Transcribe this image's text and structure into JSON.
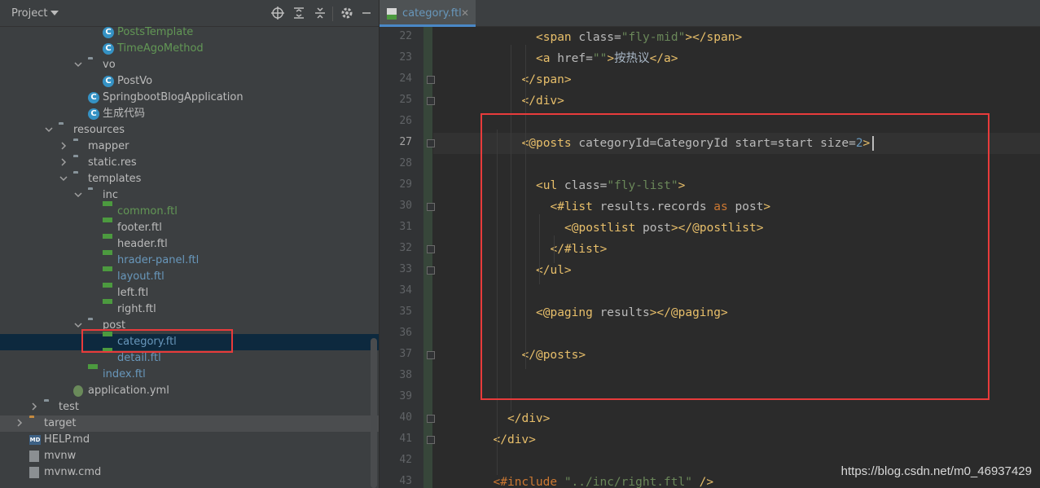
{
  "project_panel": {
    "title": "Project",
    "tree": [
      {
        "label": "PostsTemplate",
        "icon": "class-icon",
        "color": "c-green",
        "depth": 6,
        "arrow": ""
      },
      {
        "label": "TimeAgoMethod",
        "icon": "class-icon",
        "color": "c-green",
        "depth": 6,
        "arrow": ""
      },
      {
        "label": "vo",
        "icon": "folder-icon",
        "color": "c-default",
        "depth": 5,
        "arrow": "down"
      },
      {
        "label": "PostVo",
        "icon": "class-icon",
        "color": "c-default",
        "depth": 6,
        "arrow": ""
      },
      {
        "label": "SpringbootBlogApplication",
        "icon": "class-icon",
        "color": "c-default",
        "depth": 5,
        "arrow": ""
      },
      {
        "label": "生成代码",
        "icon": "class-icon",
        "color": "c-default",
        "depth": 5,
        "arrow": ""
      },
      {
        "label": "resources",
        "icon": "folder-icon",
        "color": "c-default",
        "depth": 3,
        "arrow": "down"
      },
      {
        "label": "mapper",
        "icon": "folder-icon",
        "color": "c-default",
        "depth": 4,
        "arrow": "right"
      },
      {
        "label": "static.res",
        "icon": "folder-icon",
        "color": "c-default",
        "depth": 4,
        "arrow": "right"
      },
      {
        "label": "templates",
        "icon": "folder-icon",
        "color": "c-default",
        "depth": 4,
        "arrow": "down"
      },
      {
        "label": "inc",
        "icon": "folder-icon",
        "color": "c-default",
        "depth": 5,
        "arrow": "down"
      },
      {
        "label": "common.ftl",
        "icon": "ftl-icon",
        "color": "c-green",
        "depth": 6,
        "arrow": ""
      },
      {
        "label": "footer.ftl",
        "icon": "ftl-icon",
        "color": "c-default",
        "depth": 6,
        "arrow": ""
      },
      {
        "label": "header.ftl",
        "icon": "ftl-icon",
        "color": "c-default",
        "depth": 6,
        "arrow": ""
      },
      {
        "label": "hrader-panel.ftl",
        "icon": "ftl-icon",
        "color": "c-blue",
        "depth": 6,
        "arrow": ""
      },
      {
        "label": "layout.ftl",
        "icon": "ftl-icon",
        "color": "c-blue",
        "depth": 6,
        "arrow": ""
      },
      {
        "label": "left.ftl",
        "icon": "ftl-icon",
        "color": "c-default",
        "depth": 6,
        "arrow": ""
      },
      {
        "label": "right.ftl",
        "icon": "ftl-icon",
        "color": "c-default",
        "depth": 6,
        "arrow": ""
      },
      {
        "label": "post",
        "icon": "folder-icon",
        "color": "c-default",
        "depth": 5,
        "arrow": "down"
      },
      {
        "label": "category.ftl",
        "icon": "ftl-icon",
        "color": "c-blue",
        "depth": 6,
        "arrow": "",
        "selected": true
      },
      {
        "label": "detail.ftl",
        "icon": "ftl-icon",
        "color": "c-blue",
        "depth": 6,
        "arrow": ""
      },
      {
        "label": "index.ftl",
        "icon": "ftl-icon",
        "color": "c-blue",
        "depth": 5,
        "arrow": ""
      },
      {
        "label": "application.yml",
        "icon": "yml-icon",
        "color": "c-default",
        "depth": 4,
        "arrow": ""
      },
      {
        "label": "test",
        "icon": "folder-icon",
        "color": "c-default",
        "depth": 2,
        "arrow": "right"
      },
      {
        "label": "target",
        "icon": "folder-orange",
        "color": "c-default",
        "depth": 1,
        "arrow": "right",
        "hovered": true
      },
      {
        "label": "HELP.md",
        "icon": "md-icon",
        "color": "c-default",
        "depth": 1,
        "arrow": ""
      },
      {
        "label": "mvnw",
        "icon": "file-icon",
        "color": "c-default",
        "depth": 1,
        "arrow": ""
      },
      {
        "label": "mvnw.cmd",
        "icon": "file-icon",
        "color": "c-default",
        "depth": 1,
        "arrow": ""
      }
    ]
  },
  "editor": {
    "tab_label": "category.ftl",
    "current_line": 27,
    "lines": [
      {
        "n": 22,
        "indent": 8,
        "tokens": [
          [
            "tag",
            "<span "
          ],
          [
            "attr",
            "class="
          ],
          [
            "str",
            "\"fly-mid\""
          ],
          [
            "tag",
            "></span>"
          ]
        ]
      },
      {
        "n": 23,
        "indent": 8,
        "tokens": [
          [
            "tag",
            "<a "
          ],
          [
            "attr",
            "href="
          ],
          [
            "str",
            "\"\""
          ],
          [
            "tag",
            ">"
          ],
          [
            "txt",
            "按热议"
          ],
          [
            "tag",
            "</a>"
          ]
        ]
      },
      {
        "n": 24,
        "indent": 6,
        "tokens": [
          [
            "tag",
            "</span>"
          ]
        ]
      },
      {
        "n": 25,
        "indent": 6,
        "tokens": [
          [
            "tag",
            "</div>"
          ]
        ]
      },
      {
        "n": 26,
        "indent": 0,
        "tokens": []
      },
      {
        "n": 27,
        "indent": 6,
        "tokens": [
          [
            "tag",
            "<@posts "
          ],
          [
            "attr",
            "categoryId=CategoryId start=start size="
          ],
          [
            "num",
            "2"
          ],
          [
            "tag",
            ">"
          ]
        ]
      },
      {
        "n": 28,
        "indent": 0,
        "tokens": []
      },
      {
        "n": 29,
        "indent": 8,
        "tokens": [
          [
            "tag",
            "<ul "
          ],
          [
            "attr",
            "class="
          ],
          [
            "str",
            "\"fly-list\""
          ],
          [
            "tag",
            ">"
          ]
        ]
      },
      {
        "n": 30,
        "indent": 10,
        "tokens": [
          [
            "tag",
            "<#list "
          ],
          [
            "attr",
            "results.records "
          ],
          [
            "kw",
            "as "
          ],
          [
            "attr",
            "post"
          ],
          [
            "tag",
            ">"
          ]
        ]
      },
      {
        "n": 31,
        "indent": 12,
        "tokens": [
          [
            "tag",
            "<@postlist "
          ],
          [
            "attr",
            "post"
          ],
          [
            "tag",
            "></@postlist>"
          ]
        ]
      },
      {
        "n": 32,
        "indent": 10,
        "tokens": [
          [
            "tag",
            "</#list>"
          ]
        ]
      },
      {
        "n": 33,
        "indent": 8,
        "tokens": [
          [
            "tag",
            "</ul>"
          ]
        ]
      },
      {
        "n": 34,
        "indent": 0,
        "tokens": []
      },
      {
        "n": 35,
        "indent": 8,
        "tokens": [
          [
            "tag",
            "<@paging "
          ],
          [
            "attr",
            "results"
          ],
          [
            "tag",
            "></@paging>"
          ]
        ]
      },
      {
        "n": 36,
        "indent": 0,
        "tokens": []
      },
      {
        "n": 37,
        "indent": 6,
        "tokens": [
          [
            "tag",
            "</@posts>"
          ]
        ]
      },
      {
        "n": 38,
        "indent": 0,
        "tokens": []
      },
      {
        "n": 39,
        "indent": 0,
        "tokens": []
      },
      {
        "n": 40,
        "indent": 4,
        "tokens": [
          [
            "tag",
            "</div>"
          ]
        ]
      },
      {
        "n": 41,
        "indent": 2,
        "tokens": [
          [
            "tag",
            "</div>"
          ]
        ]
      },
      {
        "n": 42,
        "indent": 0,
        "tokens": []
      },
      {
        "n": 43,
        "indent": 2,
        "tokens": [
          [
            "kw",
            "<#include "
          ],
          [
            "str",
            "\"../inc/right.ftl\""
          ],
          [
            "tag",
            " />"
          ]
        ]
      }
    ]
  },
  "watermark": "https://blog.csdn.net/m0_46937429"
}
